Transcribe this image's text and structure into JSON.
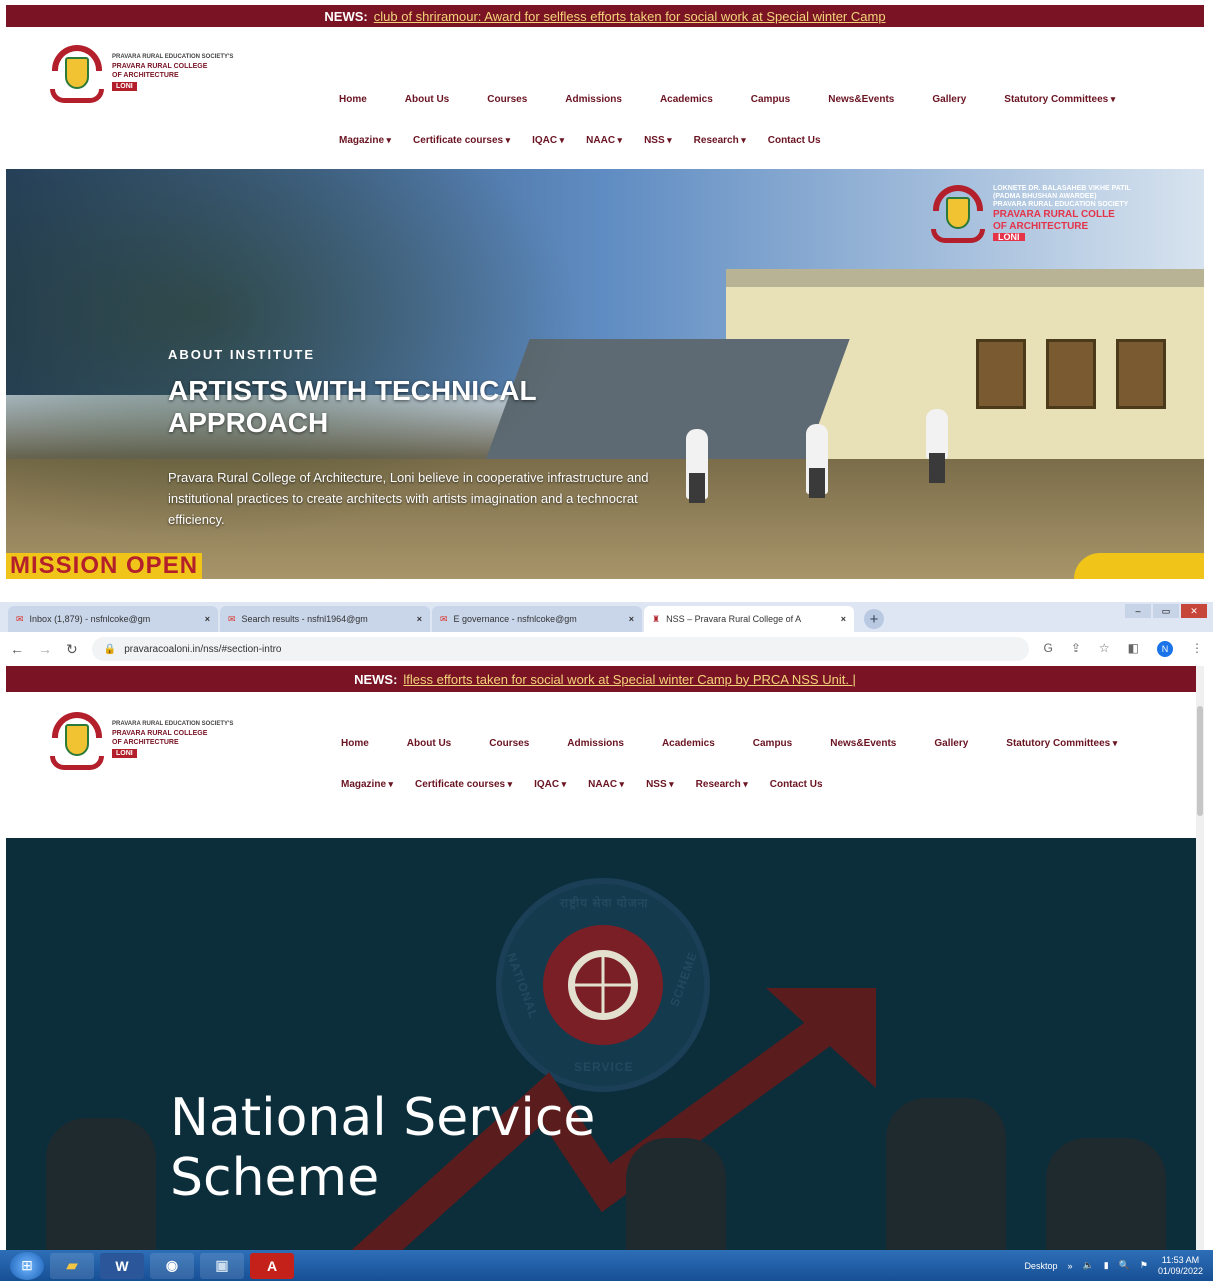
{
  "screenshot1": {
    "news": {
      "label": "NEWS:",
      "text": "club of shriramour: Award for selfless efforts taken for social work at Special winter Camp"
    },
    "logo": {
      "line1": "PRAVARA RURAL EDUCATION SOCIETY'S",
      "line2": "PRAVARA RURAL COLLEGE",
      "line3": "OF ARCHITECTURE",
      "badge": "LONI"
    },
    "nav_row1": [
      "Home",
      "About Us",
      "Courses",
      "Admissions",
      "Academics",
      "Campus",
      "News&Events",
      "Gallery",
      "Statutory Committees"
    ],
    "nav_row2": [
      "Magazine",
      "Certificate courses",
      "IQAC",
      "NAAC",
      "NSS",
      "Research",
      "Contact Us"
    ],
    "hero": {
      "logo_lines": [
        "LOKNETE DR. BALASAHEB VIKHE PATIL",
        "(PADMA BHUSHAN AWARDEE)",
        "PRAVARA RURAL EDUCATION SOCIETY"
      ],
      "logo_name1": "PRAVARA RURAL COLLE",
      "logo_name2": "OF ARCHITECTURE",
      "logo_badge": "LONI",
      "kicker": "ABOUT INSTITUTE",
      "title_line1": "ARTISTS WITH TECHNICAL",
      "title_line2": "APPROACH",
      "description": "Pravara Rural College of Architecture, Loni believe in cooperative infrastructure and institutional practices to create architects with artists imagination and a technocrat efficiency.",
      "banner": "MISSION OPEN"
    }
  },
  "browser": {
    "tabs": [
      {
        "title": "Inbox (1,879) - nsfnlcoke@gm",
        "active": false
      },
      {
        "title": "Search results - nsfnl1964@gm",
        "active": false
      },
      {
        "title": "E governance - nsfnlcoke@gm",
        "active": false
      },
      {
        "title": "NSS – Pravara Rural College of A",
        "active": true
      }
    ],
    "url": "pravaracoaloni.in/nss/#section-intro",
    "profile_initial": "N"
  },
  "screenshot2": {
    "news": {
      "label": "NEWS:",
      "text": "lfless efforts taken for social work at Special winter Camp by PRCA NSS Unit. |"
    },
    "logo": {
      "line1": "PRAVARA RURAL EDUCATION SOCIETY'S",
      "line2": "PRAVARA RURAL COLLEGE",
      "line3": "OF ARCHITECTURE",
      "badge": "LONI"
    },
    "nav_row1": [
      "Home",
      "About Us",
      "Courses",
      "Admissions",
      "Academics",
      "Campus",
      "News&Events",
      "Gallery",
      "Statutory Committees"
    ],
    "nav_row2": [
      "Magazine",
      "Certificate courses",
      "IQAC",
      "NAAC",
      "NSS",
      "Research",
      "Contact Us"
    ],
    "hero": {
      "seal_top": "राष्ट्रीय सेवा योजना",
      "seal_left": "NATIONAL",
      "seal_right": "SCHEME",
      "seal_bottom": "SERVICE",
      "title_line1": "National Service",
      "title_line2": "Scheme"
    }
  },
  "taskbar": {
    "word_label": "W",
    "pdf_label": "A",
    "desktop_label": "Desktop",
    "time": "11:53 AM",
    "date": "01/09/2022"
  },
  "colors": {
    "maroon": "#7a1424",
    "red": "#b3202c",
    "nss_bg": "#0c2e3b"
  }
}
